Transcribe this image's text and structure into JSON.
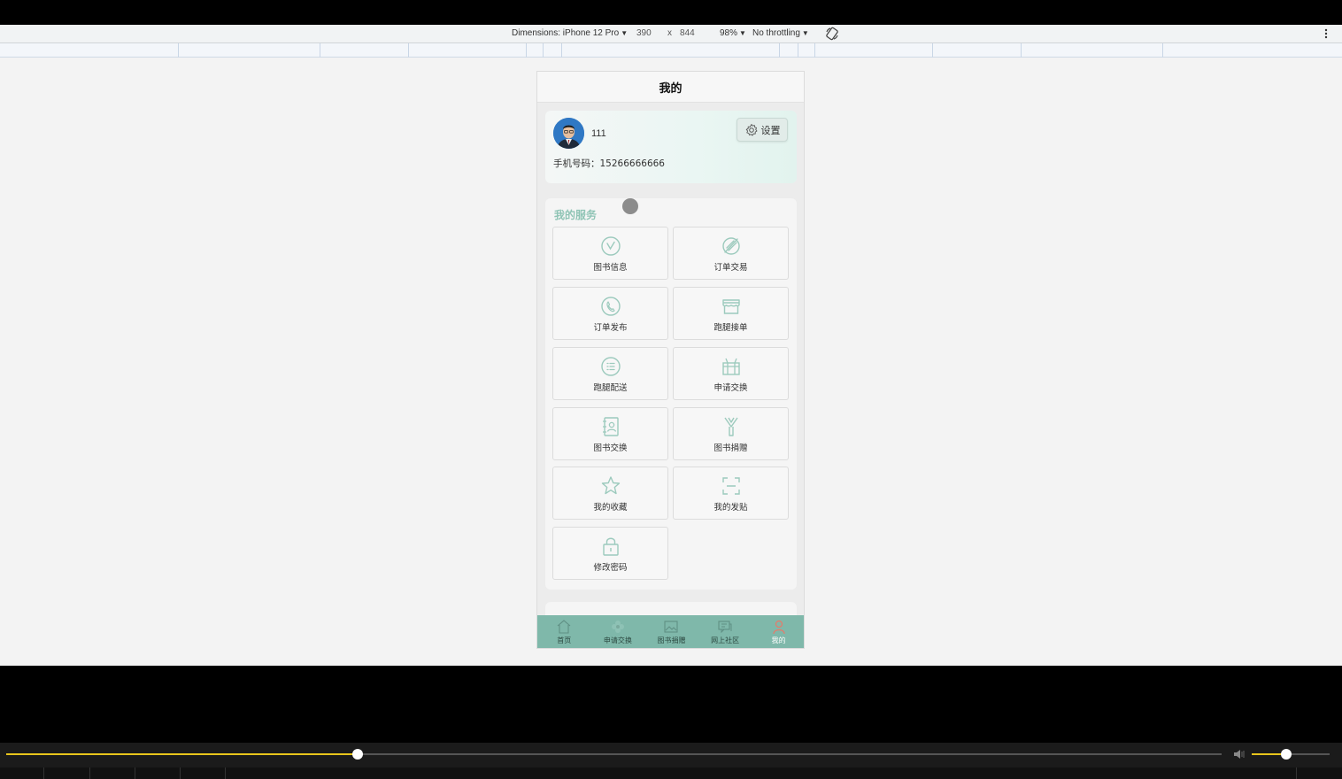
{
  "devtools": {
    "dimensions_label": "Dimensions: iPhone 12 Pro",
    "width": "390",
    "times": "x",
    "height": "844",
    "zoom": "98%",
    "throttling": "No throttling"
  },
  "page": {
    "title": "我的",
    "profile": {
      "username": "111",
      "settings_label": "设置",
      "phone_line": "手机号码：15266666666"
    },
    "services": {
      "title": "我的服务",
      "items": [
        {
          "label": "图书信息",
          "icon": "clock-icon"
        },
        {
          "label": "订单交易",
          "icon": "pen-nib-icon"
        },
        {
          "label": "订单发布",
          "icon": "phone-icon"
        },
        {
          "label": "跑腿接单",
          "icon": "shop-icon"
        },
        {
          "label": "跑腿配送",
          "icon": "list-circle-icon"
        },
        {
          "label": "申请交换",
          "icon": "gift-box-icon"
        },
        {
          "label": "图书交换",
          "icon": "contact-book-icon"
        },
        {
          "label": "图书捐赠",
          "icon": "ribbon-icon"
        },
        {
          "label": "我的收藏",
          "icon": "star-icon"
        },
        {
          "label": "我的发贴",
          "icon": "scan-frame-icon"
        },
        {
          "label": "修改密码",
          "icon": "lock-icon"
        }
      ]
    },
    "tabbar": [
      {
        "label": "首页",
        "icon": "home-icon",
        "active": false
      },
      {
        "label": "申请交换",
        "icon": "flower-icon",
        "active": false
      },
      {
        "label": "图书捐赠",
        "icon": "image-icon",
        "active": false
      },
      {
        "label": "网上社区",
        "icon": "chat-icon",
        "active": false
      },
      {
        "label": "我的",
        "icon": "user-icon",
        "active": true
      }
    ]
  },
  "player": {
    "progress": 0.289,
    "volume": 0.44
  },
  "colors": {
    "accent": "#8fc4b5",
    "tabbar": "#7fb8aa",
    "icon_stroke": "#9ccabd",
    "active_tab": "#e87a6a",
    "progress": "#e8c51c"
  }
}
